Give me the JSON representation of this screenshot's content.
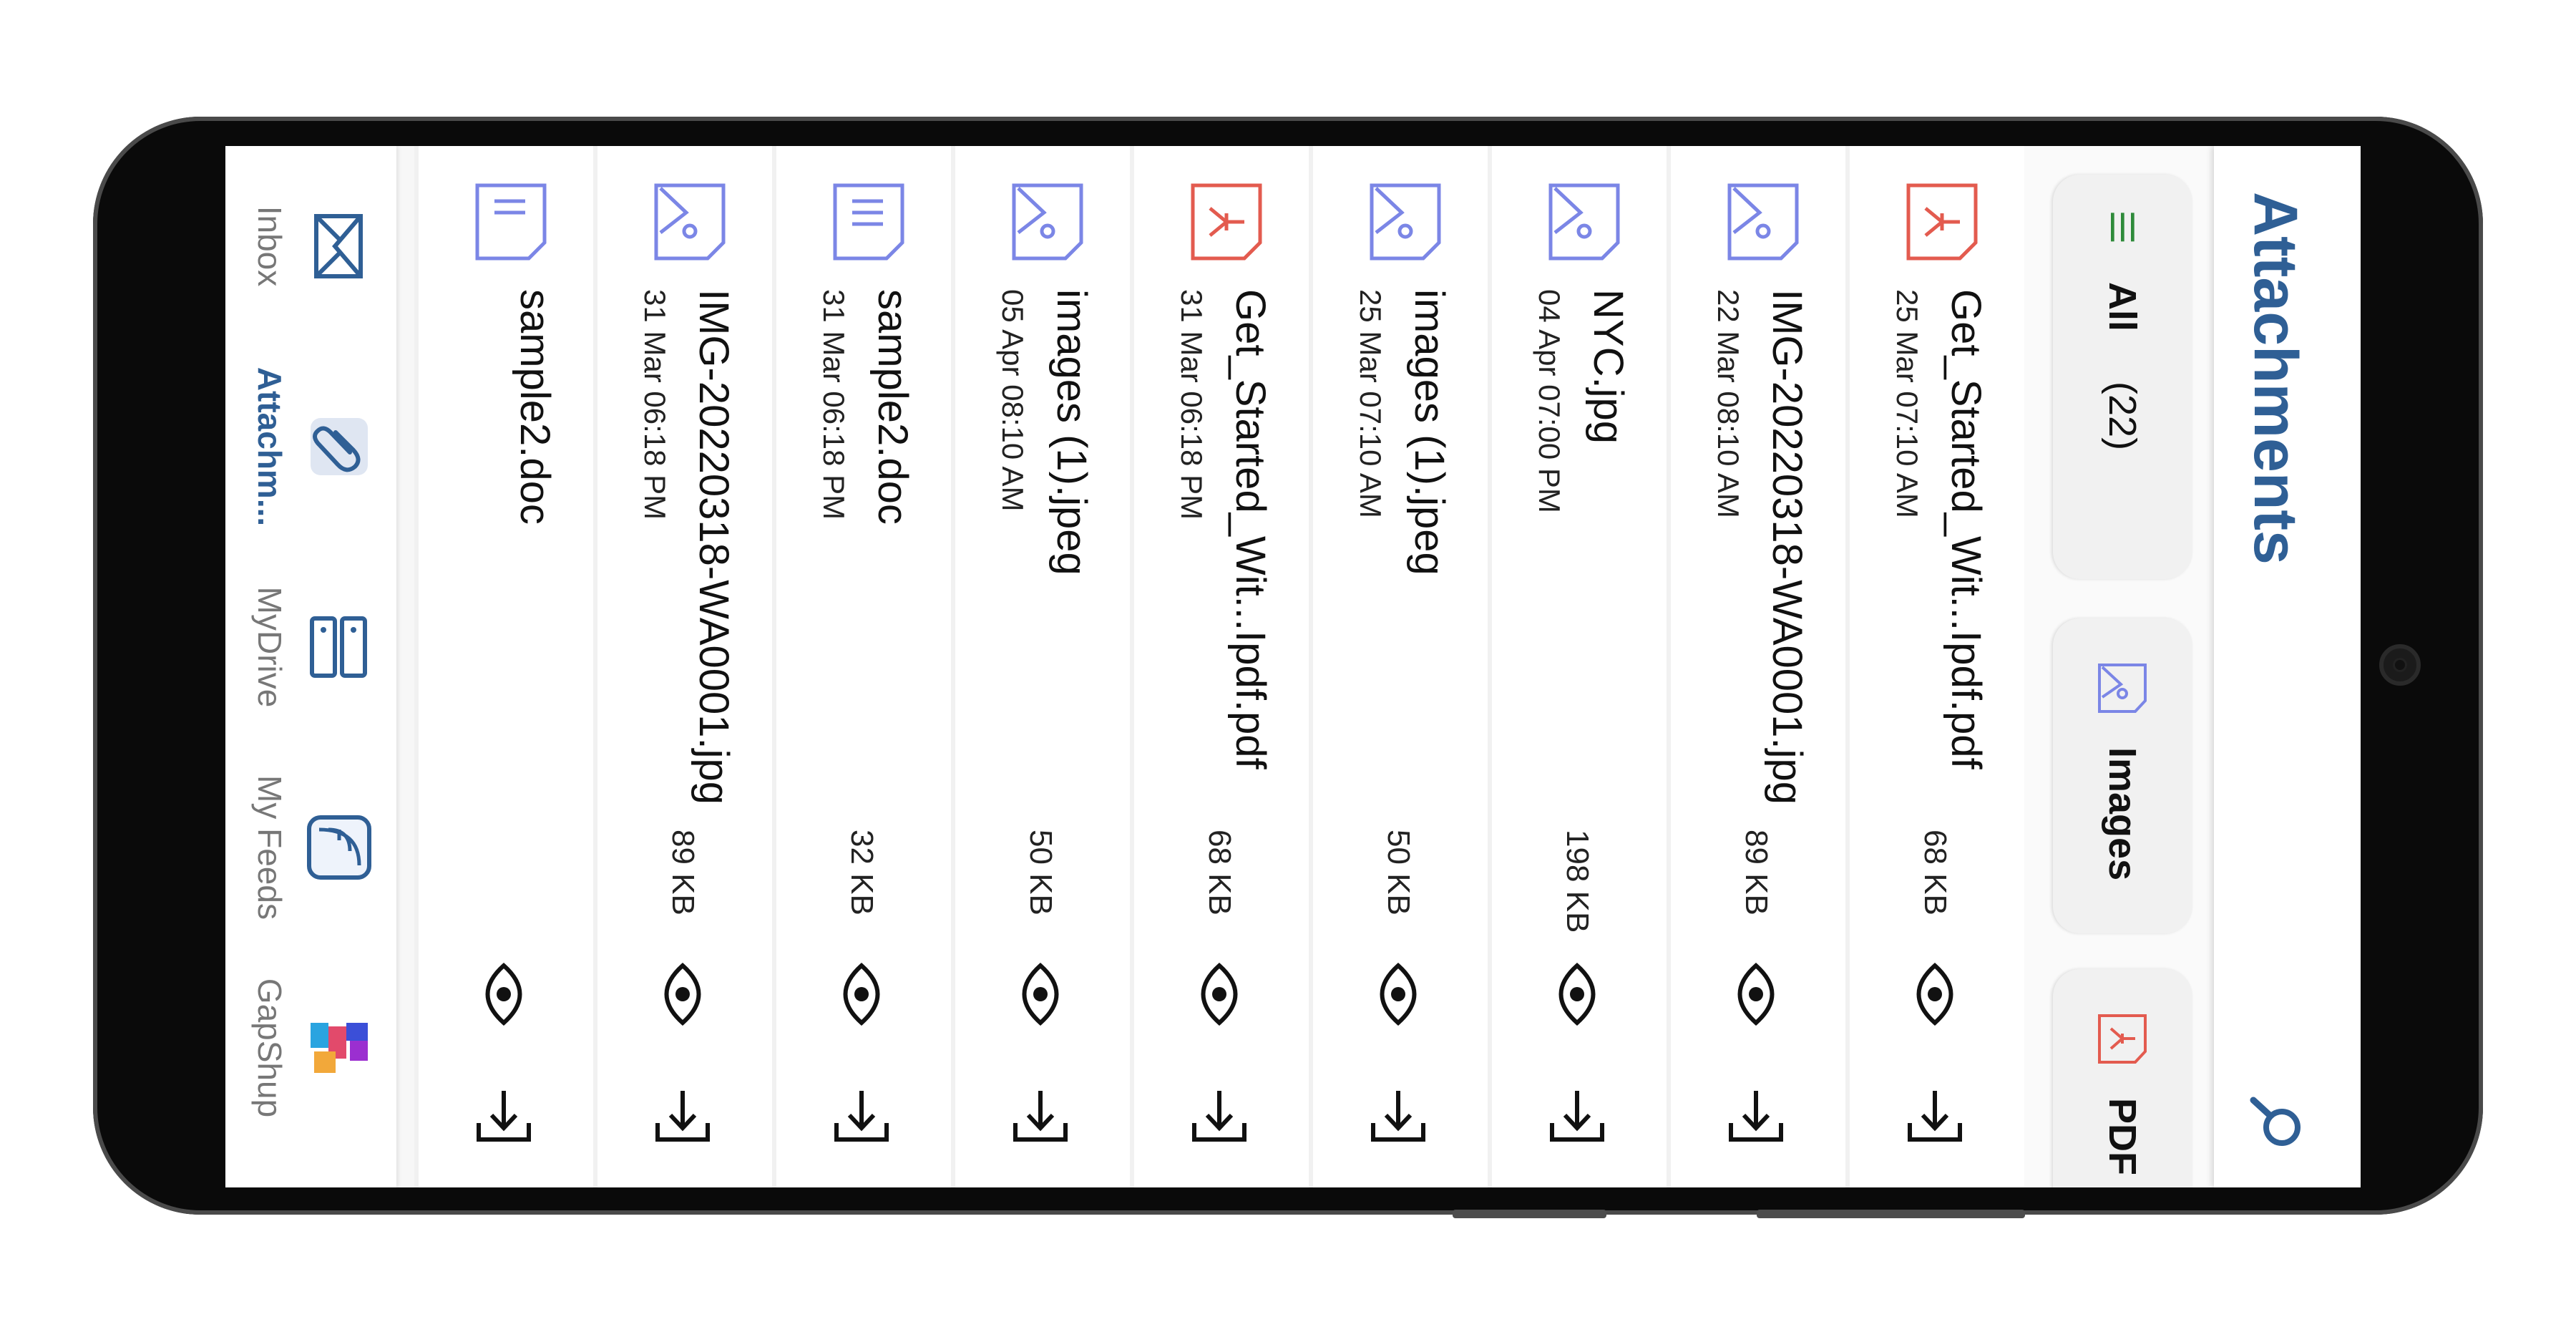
{
  "header": {
    "title": "Attachments"
  },
  "filters": {
    "all_label": "All",
    "all_count": "(22)",
    "images_label": "Images",
    "pdf_label": "PDF"
  },
  "files": [
    {
      "name": "Get_Started_Wit...Ipdf.pdf",
      "date": "25 Mar 07:10 AM",
      "size": "68 KB",
      "type": "pdf"
    },
    {
      "name": "IMG-20220318-WA0001.jpg",
      "date": "22 Mar 08:10 AM",
      "size": "89 KB",
      "type": "image"
    },
    {
      "name": "NYC.jpg",
      "date": "04 Apr 07:00 PM",
      "size": "198 KB",
      "type": "image"
    },
    {
      "name": "images (1).jpeg",
      "date": "25 Mar 07:10 AM",
      "size": "50 KB",
      "type": "image"
    },
    {
      "name": "Get_Started_Wit...Ipdf.pdf",
      "date": "31 Mar 06:18 PM",
      "size": "68 KB",
      "type": "pdf"
    },
    {
      "name": "images (1).jpeg",
      "date": "05 Apr 08:10 AM",
      "size": "50 KB",
      "type": "image"
    },
    {
      "name": "sample2.doc",
      "date": "31 Mar 06:18 PM",
      "size": "32 KB",
      "type": "doc"
    },
    {
      "name": "IMG-20220318-WA0001.jpg",
      "date": "31 Mar 06:18 PM",
      "size": "89 KB",
      "type": "image"
    },
    {
      "name": "sample2.doc",
      "date": "",
      "size": "",
      "type": "doc"
    }
  ],
  "nav": {
    "inbox": "Inbox",
    "attachments": "Attachm...",
    "mydrive": "MyDrive",
    "myfeeds": "My Feeds",
    "gapshup": "GapShup"
  },
  "colors": {
    "accent": "#2f5f95",
    "pdf": "#e35b4f",
    "image": "#7b86e6",
    "doc": "#7b86e6",
    "green": "#2e8b3a"
  }
}
